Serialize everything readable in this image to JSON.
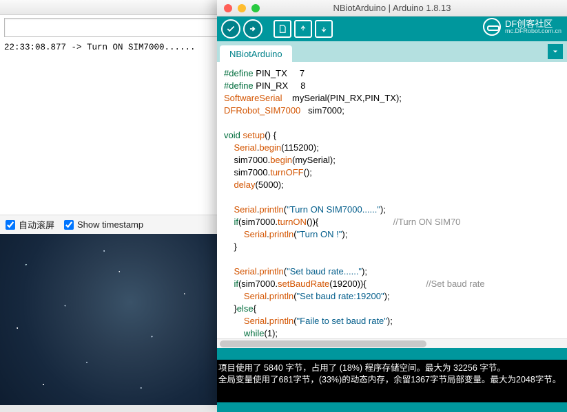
{
  "serial": {
    "log_line": "22:33:08.877 -> Turn ON SIM7000......",
    "autoscroll_label": "自动滚屏",
    "timestamp_label": "Show timestamp"
  },
  "arduino": {
    "window_title": "NBiotArduino | Arduino 1.8.13",
    "brand_title": "DF创客社区",
    "brand_sub": "mc.DFRobot.com.cn",
    "tab_name": "NBiotArduino",
    "code": {
      "l1_a": "#define",
      "l1_b": " PIN_TX     7",
      "l2_a": "#define",
      "l2_b": " PIN_RX     8",
      "l3_a": "SoftwareSerial",
      "l3_b": "    mySerial(PIN_RX,PIN_TX);",
      "l4_a": "DFRobot_SIM7000",
      "l4_b": "   sim7000;",
      "l5": "",
      "l6_a": "void",
      "l6_b": " ",
      "l6_c": "setup",
      "l6_d": "() {",
      "l7_a": "    ",
      "l7_b": "Serial",
      "l7_c": ".",
      "l7_d": "begin",
      "l7_e": "(115200);",
      "l8_a": "    sim7000.",
      "l8_b": "begin",
      "l8_c": "(mySerial);",
      "l9_a": "    sim7000.",
      "l9_b": "turnOFF",
      "l9_c": "();",
      "l10_a": "    ",
      "l10_b": "delay",
      "l10_c": "(5000);",
      "l11": "",
      "l12_a": "    ",
      "l12_b": "Serial",
      "l12_c": ".",
      "l12_d": "println",
      "l12_e": "(",
      "l12_f": "\"Turn ON SIM7000......\"",
      "l12_g": ");",
      "l13_a": "    ",
      "l13_b": "if",
      "l13_c": "(sim7000.",
      "l13_d": "turnON",
      "l13_e": "()){",
      "l13_cm": "                              //Turn ON SIM70",
      "l14_a": "        ",
      "l14_b": "Serial",
      "l14_c": ".",
      "l14_d": "println",
      "l14_e": "(",
      "l14_f": "\"Turn ON !\"",
      "l14_g": ");",
      "l15": "    }",
      "l16": "",
      "l17_a": "    ",
      "l17_b": "Serial",
      "l17_c": ".",
      "l17_d": "println",
      "l17_e": "(",
      "l17_f": "\"Set baud rate......\"",
      "l17_g": ");",
      "l18_a": "    ",
      "l18_b": "if",
      "l18_c": "(sim7000.",
      "l18_d": "setBaudRate",
      "l18_e": "(19200)){",
      "l18_cm": "                        //Set baud rate",
      "l19_a": "        ",
      "l19_b": "Serial",
      "l19_c": ".",
      "l19_d": "println",
      "l19_e": "(",
      "l19_f": "\"Set baud rate:19200\"",
      "l19_g": ");",
      "l20_a": "    }",
      "l20_b": "else",
      "l20_c": "{",
      "l21_a": "        ",
      "l21_b": "Serial",
      "l21_c": ".",
      "l21_d": "println",
      "l21_e": "(",
      "l21_f": "\"Faile to set baud rate\"",
      "l21_g": ");",
      "l22_a": "        ",
      "l22_b": "while",
      "l22_c": "(1);",
      "l23": "    }"
    },
    "console_line1": "项目使用了 5840 字节，占用了 (18%) 程序存储空间。最大为 32256 字节。",
    "console_line2": "全局变量使用了681字节，(33%)的动态内存，余留1367字节局部变量。最大为2048字节。"
  }
}
